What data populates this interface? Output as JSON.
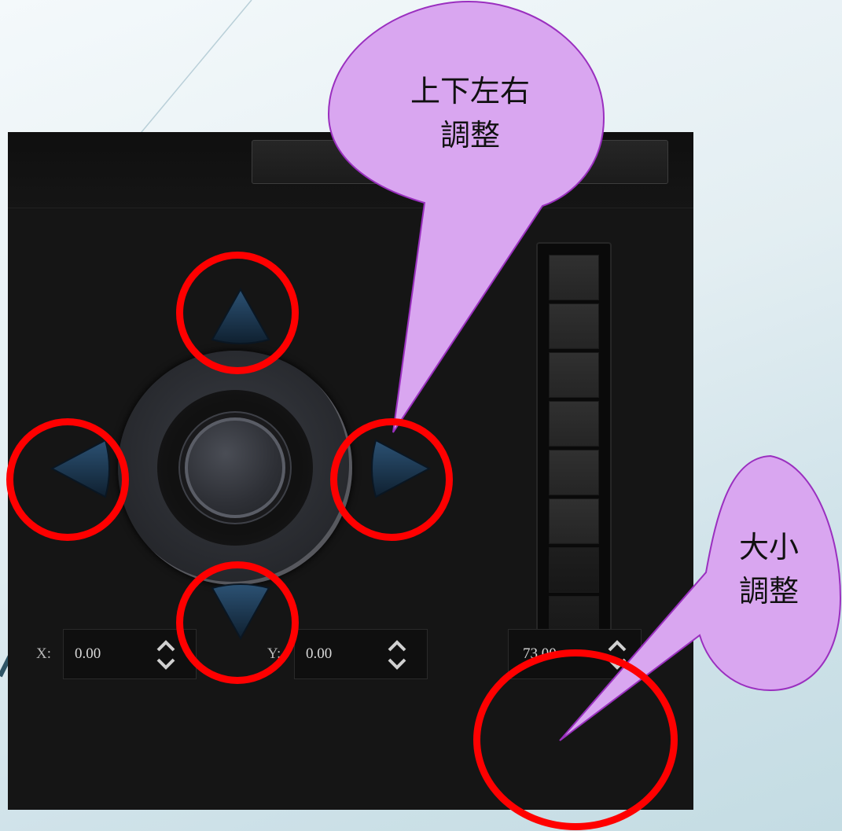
{
  "callouts": {
    "position": {
      "line1": "上下左右",
      "line2": "調整"
    },
    "size": {
      "line1": "大小",
      "line2": "調整"
    }
  },
  "position_controls": {
    "x_label": "X:",
    "x_value": "0.00",
    "y_label": "Y:",
    "y_value": "0.00"
  },
  "size_control": {
    "value": "73.00"
  },
  "colors": {
    "highlight": "#ff0000",
    "callout_fill": "#d9a6f0",
    "callout_stroke": "#9a2fbf",
    "panel": "#151515",
    "arrow": "#1b3550"
  },
  "icons": [
    "arrow-up-icon",
    "arrow-down-icon",
    "arrow-left-icon",
    "arrow-right-icon",
    "spinner-icon"
  ]
}
